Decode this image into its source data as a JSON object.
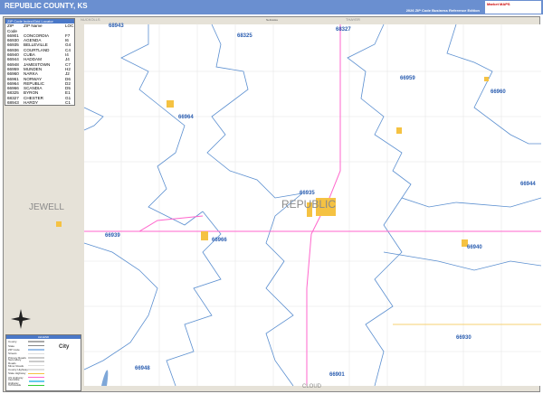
{
  "header": {
    "title": "REPUBLIC COUNTY, KS",
    "edition": "2026 ZIP Code Business Reference Edition",
    "logo_text": "Market MAPS"
  },
  "zip_table": {
    "title": "ZIP Code Index/Grid Locator",
    "columns": [
      "ZIP Code",
      "ZIP Name",
      "LOC"
    ],
    "rows": [
      [
        "66901",
        "CONCORDIA",
        "F7"
      ],
      [
        "66930",
        "AGENDA",
        "I6"
      ],
      [
        "66935",
        "BELLEVILLE",
        "G4"
      ],
      [
        "66936",
        "COURTLAND",
        "C4"
      ],
      [
        "66940",
        "CUBA",
        "I4"
      ],
      [
        "66944",
        "HADDAM",
        "J4"
      ],
      [
        "66948",
        "JAMESTOWN",
        "C7"
      ],
      [
        "66959",
        "MUNDEN",
        "H2"
      ],
      [
        "66960",
        "NARKA",
        "J2"
      ],
      [
        "66961",
        "NORWAY",
        "D6"
      ],
      [
        "66964",
        "REPUBLIC",
        "D2"
      ],
      [
        "66966",
        "SCANDIA",
        "D5"
      ],
      [
        "68325",
        "BYRON",
        "E1"
      ],
      [
        "68327",
        "CHESTER",
        "G1"
      ],
      [
        "68943",
        "HARDY",
        "C1"
      ]
    ]
  },
  "map": {
    "zip_labels": [
      {
        "text": "68943"
      },
      {
        "text": "68325"
      },
      {
        "text": "68327"
      },
      {
        "text": "66959"
      },
      {
        "text": "66960"
      },
      {
        "text": "66964"
      },
      {
        "text": "66935"
      },
      {
        "text": "66944"
      },
      {
        "text": "66939"
      },
      {
        "text": "66966"
      },
      {
        "text": "66940"
      },
      {
        "text": "66930"
      },
      {
        "text": "66948"
      },
      {
        "text": "66901"
      }
    ],
    "county_labels": {
      "center": "REPUBLIC",
      "west": "JEWELL",
      "south": "CLOUD",
      "north_west": "NUCKOLLS",
      "north_east": "THAYER",
      "state_north": "Nebraska"
    },
    "colors": {
      "zip_boundary": "#5b8fd0",
      "highway": "#ff66cc",
      "city": "#f5c242",
      "neighbor": "#e6e2d8",
      "label": "#2a5db0"
    }
  },
  "legend": {
    "title": "LEGEND",
    "items": [
      "County",
      "State",
      "ZIP Code",
      "Streets",
      "Primary Roads",
      "Secondary Roads",
      "Minor Roads",
      "County Highway",
      "State Highway",
      "US Highway",
      "Interstate Highway",
      "Toll Roads"
    ],
    "city_label": "City"
  }
}
